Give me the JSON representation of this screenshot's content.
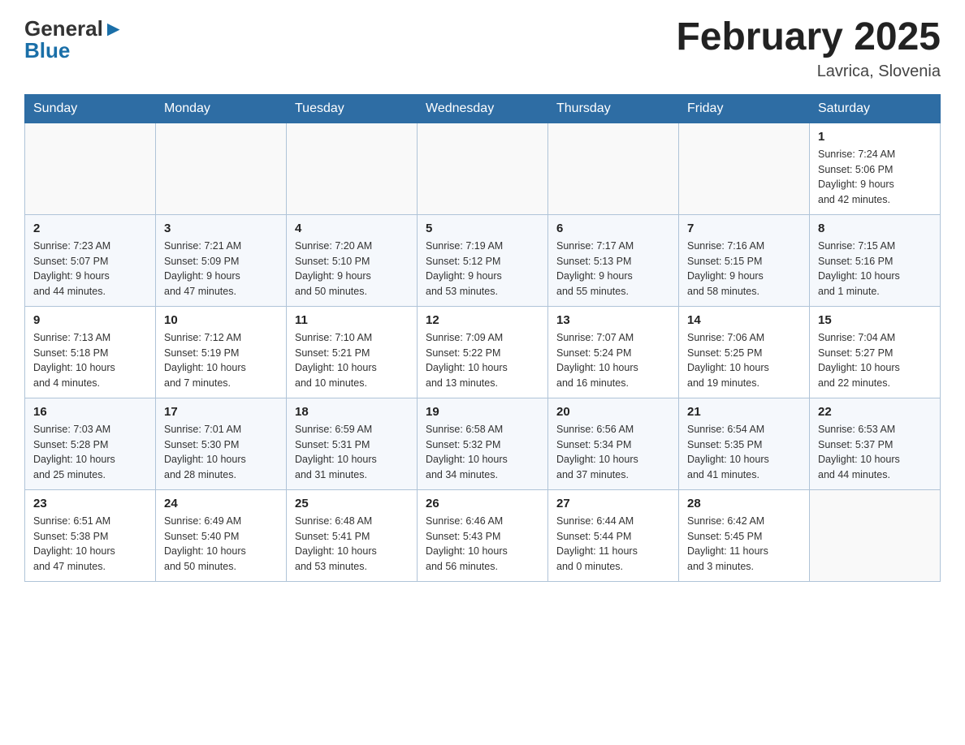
{
  "header": {
    "logo_general": "General",
    "logo_blue": "Blue",
    "month_title": "February 2025",
    "location": "Lavrica, Slovenia"
  },
  "days_of_week": [
    "Sunday",
    "Monday",
    "Tuesday",
    "Wednesday",
    "Thursday",
    "Friday",
    "Saturday"
  ],
  "weeks": [
    [
      {
        "day": "",
        "info": ""
      },
      {
        "day": "",
        "info": ""
      },
      {
        "day": "",
        "info": ""
      },
      {
        "day": "",
        "info": ""
      },
      {
        "day": "",
        "info": ""
      },
      {
        "day": "",
        "info": ""
      },
      {
        "day": "1",
        "info": "Sunrise: 7:24 AM\nSunset: 5:06 PM\nDaylight: 9 hours\nand 42 minutes."
      }
    ],
    [
      {
        "day": "2",
        "info": "Sunrise: 7:23 AM\nSunset: 5:07 PM\nDaylight: 9 hours\nand 44 minutes."
      },
      {
        "day": "3",
        "info": "Sunrise: 7:21 AM\nSunset: 5:09 PM\nDaylight: 9 hours\nand 47 minutes."
      },
      {
        "day": "4",
        "info": "Sunrise: 7:20 AM\nSunset: 5:10 PM\nDaylight: 9 hours\nand 50 minutes."
      },
      {
        "day": "5",
        "info": "Sunrise: 7:19 AM\nSunset: 5:12 PM\nDaylight: 9 hours\nand 53 minutes."
      },
      {
        "day": "6",
        "info": "Sunrise: 7:17 AM\nSunset: 5:13 PM\nDaylight: 9 hours\nand 55 minutes."
      },
      {
        "day": "7",
        "info": "Sunrise: 7:16 AM\nSunset: 5:15 PM\nDaylight: 9 hours\nand 58 minutes."
      },
      {
        "day": "8",
        "info": "Sunrise: 7:15 AM\nSunset: 5:16 PM\nDaylight: 10 hours\nand 1 minute."
      }
    ],
    [
      {
        "day": "9",
        "info": "Sunrise: 7:13 AM\nSunset: 5:18 PM\nDaylight: 10 hours\nand 4 minutes."
      },
      {
        "day": "10",
        "info": "Sunrise: 7:12 AM\nSunset: 5:19 PM\nDaylight: 10 hours\nand 7 minutes."
      },
      {
        "day": "11",
        "info": "Sunrise: 7:10 AM\nSunset: 5:21 PM\nDaylight: 10 hours\nand 10 minutes."
      },
      {
        "day": "12",
        "info": "Sunrise: 7:09 AM\nSunset: 5:22 PM\nDaylight: 10 hours\nand 13 minutes."
      },
      {
        "day": "13",
        "info": "Sunrise: 7:07 AM\nSunset: 5:24 PM\nDaylight: 10 hours\nand 16 minutes."
      },
      {
        "day": "14",
        "info": "Sunrise: 7:06 AM\nSunset: 5:25 PM\nDaylight: 10 hours\nand 19 minutes."
      },
      {
        "day": "15",
        "info": "Sunrise: 7:04 AM\nSunset: 5:27 PM\nDaylight: 10 hours\nand 22 minutes."
      }
    ],
    [
      {
        "day": "16",
        "info": "Sunrise: 7:03 AM\nSunset: 5:28 PM\nDaylight: 10 hours\nand 25 minutes."
      },
      {
        "day": "17",
        "info": "Sunrise: 7:01 AM\nSunset: 5:30 PM\nDaylight: 10 hours\nand 28 minutes."
      },
      {
        "day": "18",
        "info": "Sunrise: 6:59 AM\nSunset: 5:31 PM\nDaylight: 10 hours\nand 31 minutes."
      },
      {
        "day": "19",
        "info": "Sunrise: 6:58 AM\nSunset: 5:32 PM\nDaylight: 10 hours\nand 34 minutes."
      },
      {
        "day": "20",
        "info": "Sunrise: 6:56 AM\nSunset: 5:34 PM\nDaylight: 10 hours\nand 37 minutes."
      },
      {
        "day": "21",
        "info": "Sunrise: 6:54 AM\nSunset: 5:35 PM\nDaylight: 10 hours\nand 41 minutes."
      },
      {
        "day": "22",
        "info": "Sunrise: 6:53 AM\nSunset: 5:37 PM\nDaylight: 10 hours\nand 44 minutes."
      }
    ],
    [
      {
        "day": "23",
        "info": "Sunrise: 6:51 AM\nSunset: 5:38 PM\nDaylight: 10 hours\nand 47 minutes."
      },
      {
        "day": "24",
        "info": "Sunrise: 6:49 AM\nSunset: 5:40 PM\nDaylight: 10 hours\nand 50 minutes."
      },
      {
        "day": "25",
        "info": "Sunrise: 6:48 AM\nSunset: 5:41 PM\nDaylight: 10 hours\nand 53 minutes."
      },
      {
        "day": "26",
        "info": "Sunrise: 6:46 AM\nSunset: 5:43 PM\nDaylight: 10 hours\nand 56 minutes."
      },
      {
        "day": "27",
        "info": "Sunrise: 6:44 AM\nSunset: 5:44 PM\nDaylight: 11 hours\nand 0 minutes."
      },
      {
        "day": "28",
        "info": "Sunrise: 6:42 AM\nSunset: 5:45 PM\nDaylight: 11 hours\nand 3 minutes."
      },
      {
        "day": "",
        "info": ""
      }
    ]
  ]
}
